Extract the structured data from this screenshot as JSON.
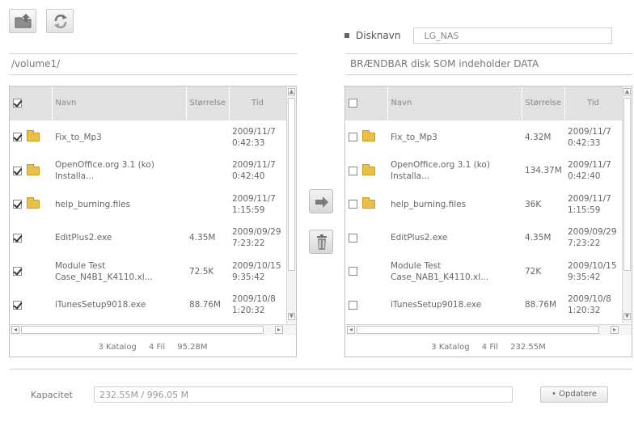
{
  "toolbar": {
    "upload_icon": "folder-upload-icon",
    "refresh_icon": "refresh-icon"
  },
  "left": {
    "path": "/volume1/",
    "headers": {
      "name": "Navn",
      "size": "Størrelse",
      "time": "Tid"
    },
    "header_checked": true,
    "rows": [
      {
        "checked": true,
        "folder": true,
        "name": "Fix_to_Mp3",
        "size": "",
        "time": "2009/11/7 0:42:33"
      },
      {
        "checked": true,
        "folder": true,
        "name": "OpenOffice.org 3.1 (ko) Installa...",
        "size": "",
        "time": "2009/11/7 0:42:40"
      },
      {
        "checked": true,
        "folder": true,
        "name": "help_burning.files",
        "size": "",
        "time": "2009/11/7 1:15:59"
      },
      {
        "checked": true,
        "folder": false,
        "name": "EditPlus2.exe",
        "size": "4.35M",
        "time": "2009/09/29 7:23:22"
      },
      {
        "checked": true,
        "folder": false,
        "name": "Module Test Case_N4B1_K4110.xl...",
        "size": "72.5K",
        "time": "2009/10/15 9:35:42"
      },
      {
        "checked": true,
        "folder": false,
        "name": "iTunesSetup9018.exe",
        "size": "88.76M",
        "time": "2009/10/8 1:20:32"
      }
    ],
    "summary": {
      "catalog": "3 Katalog",
      "files": "4 Fil",
      "total": "95.28M"
    }
  },
  "right": {
    "disk_label": "Disknavn",
    "disk_value": "LG_NAS",
    "title": "BRÆNDBAR disk SOM indeholder DATA",
    "headers": {
      "name": "Navn",
      "size": "Størrelse",
      "time": "Tid"
    },
    "header_checked": false,
    "rows": [
      {
        "checked": false,
        "folder": true,
        "name": "Fix_to_Mp3",
        "size": "4.32M",
        "time": "2009/11/7 0:42:33"
      },
      {
        "checked": false,
        "folder": true,
        "name": "OpenOffice.org 3.1 (ko) Installa...",
        "size": "134.37M",
        "time": "2009/11/7 0:42:40"
      },
      {
        "checked": false,
        "folder": true,
        "name": "help_burning.files",
        "size": "36K",
        "time": "2009/11/7 1:15:59"
      },
      {
        "checked": false,
        "folder": false,
        "name": "EditPlus2.exe",
        "size": "4.35M",
        "time": "2009/09/29 7:23:22"
      },
      {
        "checked": false,
        "folder": false,
        "name": "Module Test Case_NAB1_K4110.xl...",
        "size": "72K",
        "time": "2009/10/15 9:35:42"
      },
      {
        "checked": false,
        "folder": false,
        "name": "iTunesSetup9018.exe",
        "size": "88.76M",
        "time": "2009/10/8 1:20:32"
      }
    ],
    "summary": {
      "catalog": "3 Katalog",
      "files": "4 Fil",
      "total": "232.55M"
    }
  },
  "middle": {
    "transfer_icon": "arrow-right-icon",
    "delete_icon": "trash-icon"
  },
  "bottom": {
    "capacity_label": "Kapacitet",
    "capacity_value": "232.55M / 996.05 M",
    "update_label": "• Opdatere"
  }
}
